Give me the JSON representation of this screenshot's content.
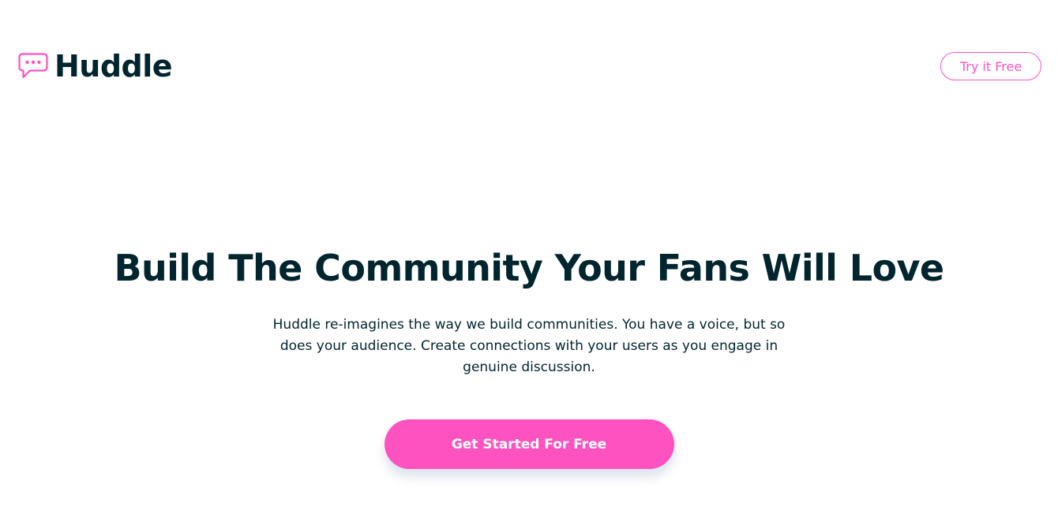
{
  "brand": {
    "name": "Huddle",
    "icon": "chat-bubble-icon",
    "accent_color": "#ff52c1",
    "text_color": "#00252e"
  },
  "header": {
    "try_button_label": "Try it Free"
  },
  "hero": {
    "title": "Build The Community Your Fans Will Love",
    "description": "Huddle re-imagines the way we build communities. You have a voice, but so does your audience. Create connections with your users as you engage in genuine discussion.",
    "cta_label": "Get Started For Free"
  }
}
